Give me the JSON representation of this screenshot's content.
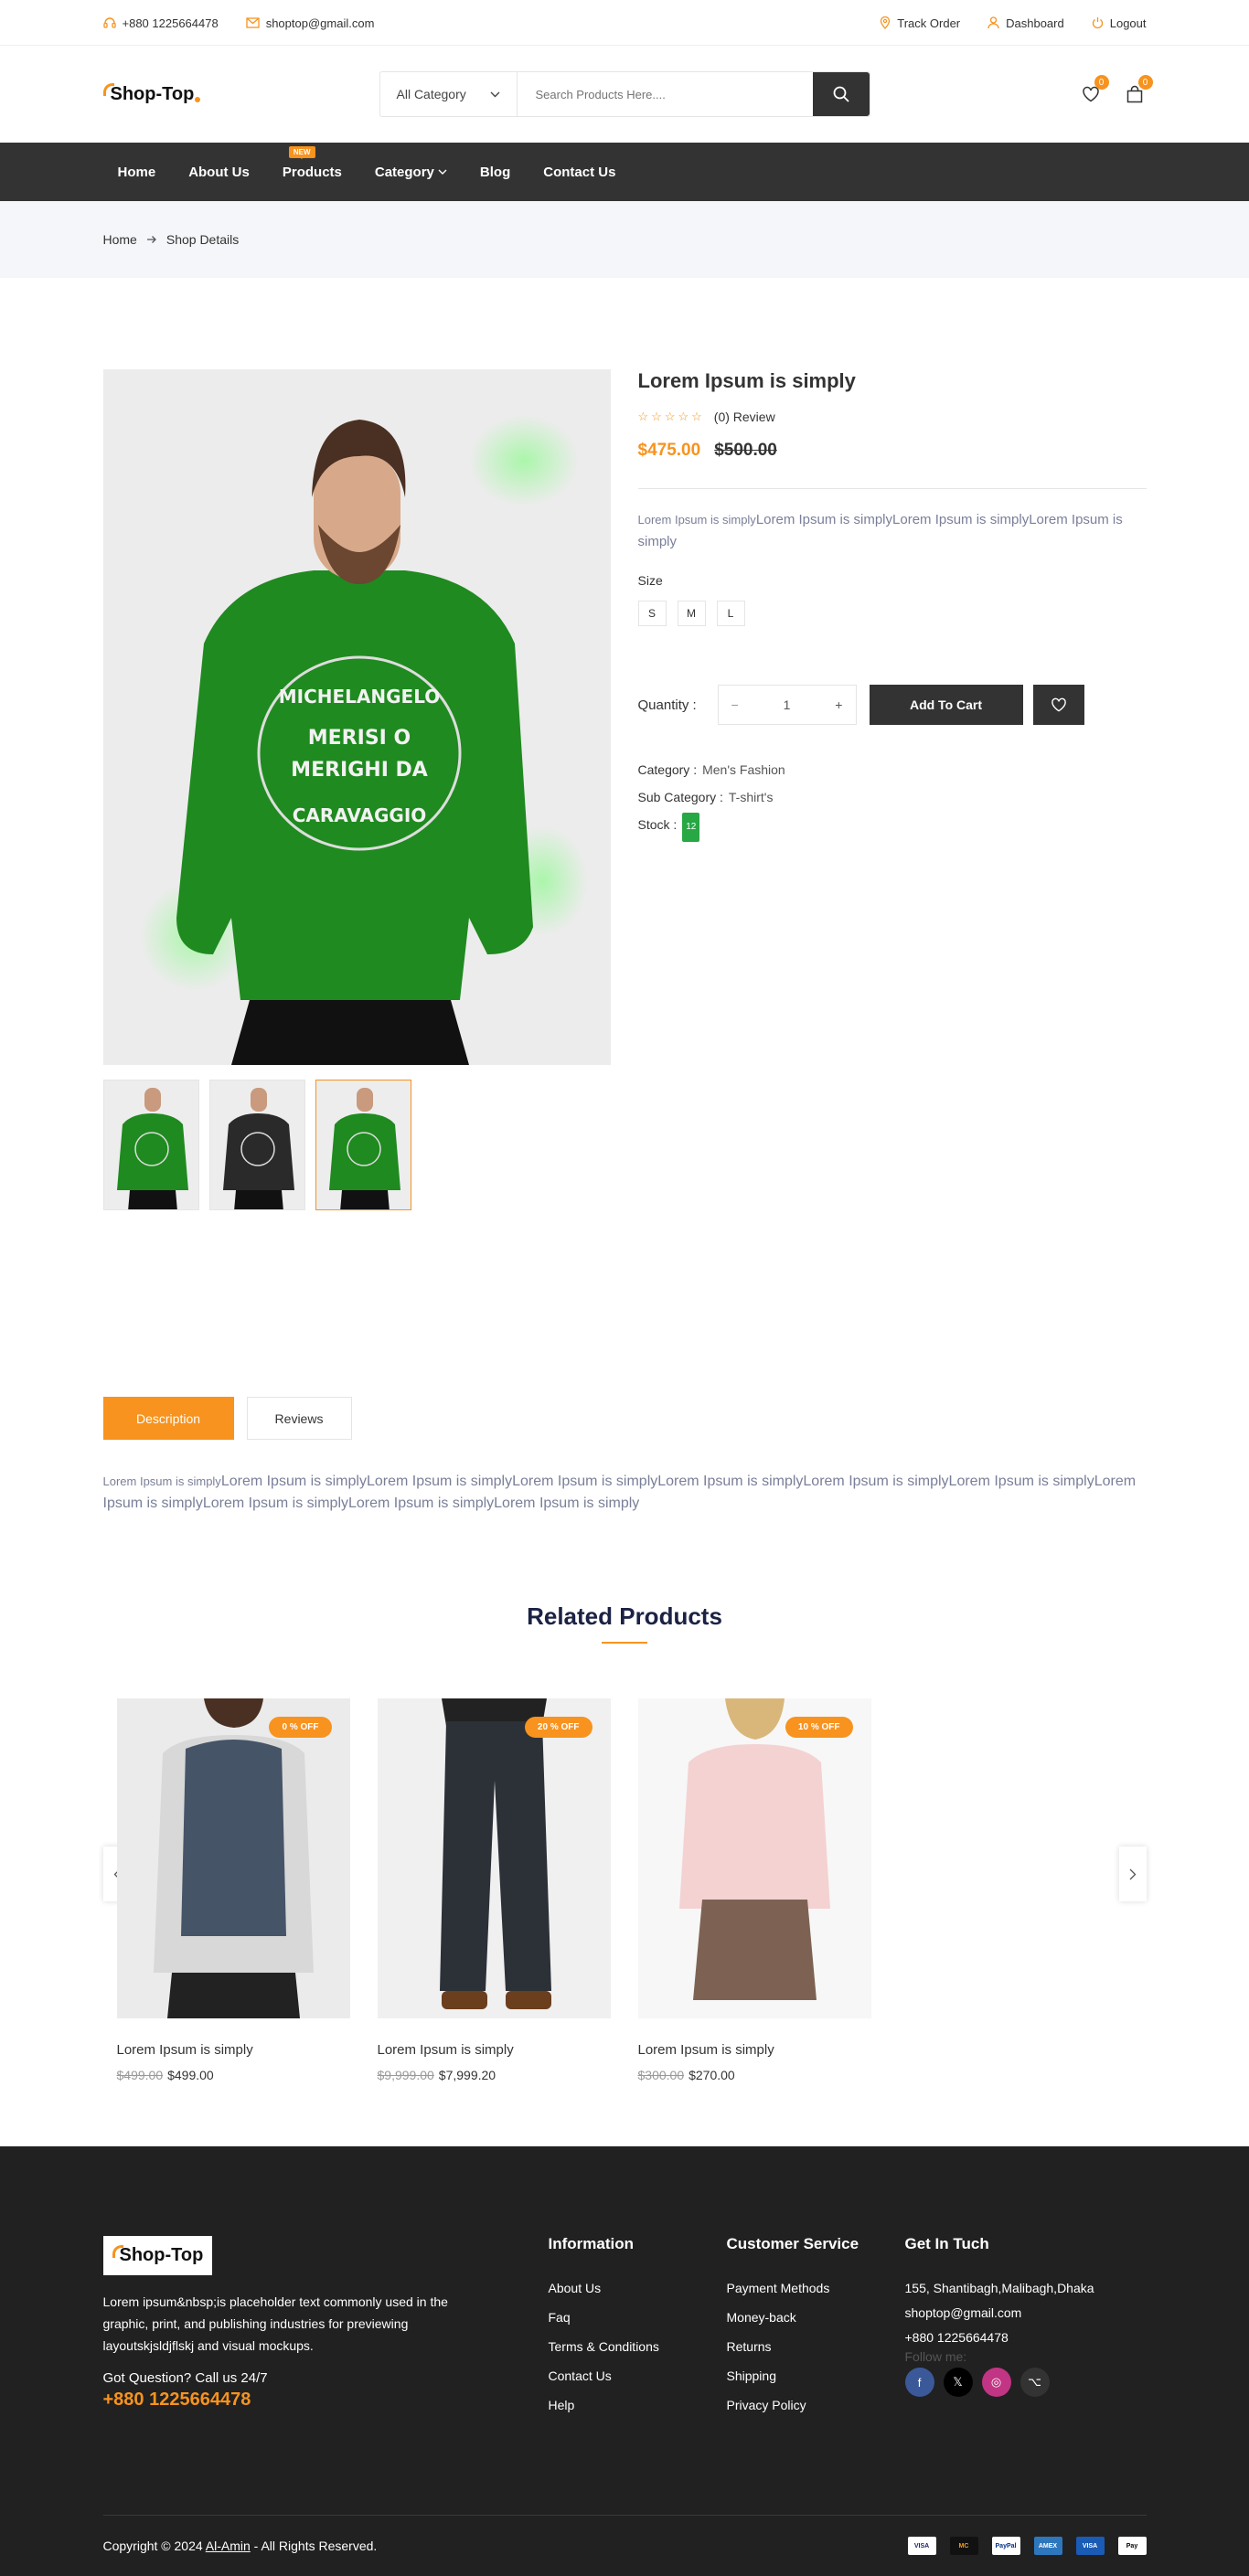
{
  "topbar": {
    "phone": "+880 1225664478",
    "email": "shoptop@gmail.com",
    "track_order": "Track Order",
    "dashboard": "Dashboard",
    "logout": "Logout"
  },
  "header": {
    "logo": "Shop-Top",
    "category_select": "All Category",
    "search_placeholder": "Search Products Here....",
    "wishlist_count": "0",
    "cart_count": "0"
  },
  "nav": {
    "items": [
      "Home",
      "About Us",
      "Products",
      "Category",
      "Blog",
      "Contact Us"
    ],
    "new_tag": "NEW"
  },
  "breadcrumb": {
    "home": "Home",
    "current": "Shop Details"
  },
  "product": {
    "title": "Lorem Ipsum is simply",
    "review_text": "(0) Review",
    "rating": 0,
    "price_new": "$475.00",
    "price_old": "$500.00",
    "desc_small": "Lorem Ipsum is simply",
    "desc_large": "Lorem Ipsum is simplyLorem Ipsum is simplyLorem Ipsum is simply",
    "size_label": "Size",
    "sizes": [
      "S",
      "M",
      "L"
    ],
    "quantity_label": "Quantity :",
    "quantity_value": "1",
    "qty_minus": "−",
    "qty_plus": "+",
    "add_to_cart": "Add To Cart",
    "category_label": "Category :",
    "category_value": "Men's Fashion",
    "subcategory_label": "Sub Category :",
    "subcategory_value": "T-shirt's",
    "stock_label": "Stock :",
    "stock_value": "12",
    "shirt_text": [
      "MICHELANGELO",
      "MERISI O",
      "MERIGHI DA",
      "CARAVAGGIO"
    ]
  },
  "tabs": {
    "description": "Description",
    "reviews": "Reviews",
    "text_small": "Lorem Ipsum is simply",
    "text_large": "Lorem Ipsum is simplyLorem Ipsum is simplyLorem Ipsum is simplyLorem Ipsum is simplyLorem Ipsum is simplyLorem Ipsum is simplyLorem Ipsum is simplyLorem Ipsum is simplyLorem Ipsum is simplyLorem Ipsum is simply"
  },
  "related": {
    "title": "Related Products",
    "items": [
      {
        "discount": "0 % OFF",
        "name": "Lorem Ipsum is simply",
        "old": "$499.00",
        "new": "$499.00"
      },
      {
        "discount": "20 % OFF",
        "name": "Lorem Ipsum is simply",
        "old": "$9,999.00",
        "new": "$7,999.20"
      },
      {
        "discount": "10 % OFF",
        "name": "Lorem Ipsum is simply",
        "old": "$300.00",
        "new": "$270.00"
      }
    ]
  },
  "footer": {
    "logo": "Shop-Top",
    "about": "Lorem ipsum&nbsp;is placeholder text commonly used in the graphic, print, and publishing industries for previewing layoutskjsldjflskj and visual mockups.",
    "question": "Got Question? Call us 24/7",
    "phone": "+880 1225664478",
    "info_title": "Information",
    "info_links": [
      "About Us",
      "Faq",
      "Terms & Conditions",
      "Contact Us",
      "Help"
    ],
    "cs_title": "Customer Service",
    "cs_links": [
      "Payment Methods",
      "Money-back",
      "Returns",
      "Shipping",
      "Privacy Policy"
    ],
    "get_title": "Get In Tuch",
    "address": "155, Shantibagh,Malibagh,Dhaka",
    "email": "shoptop@gmail.com",
    "contact_phone": "+880 1225664478",
    "follow": "Follow me:",
    "social": [
      "f",
      "𝕏",
      "◎",
      "⌥"
    ],
    "copyright_pre": "Copyright © 2024 ",
    "copyright_author": "Al-Amin",
    "copyright_post": " - All Rights Reserved.",
    "payments": [
      "VISA",
      "MC",
      "PayPal",
      "AMEX",
      "VISA",
      "Pay"
    ]
  },
  "colors": {
    "accent": "#f7931e",
    "dark": "#333333",
    "footer_bg": "#212121"
  }
}
